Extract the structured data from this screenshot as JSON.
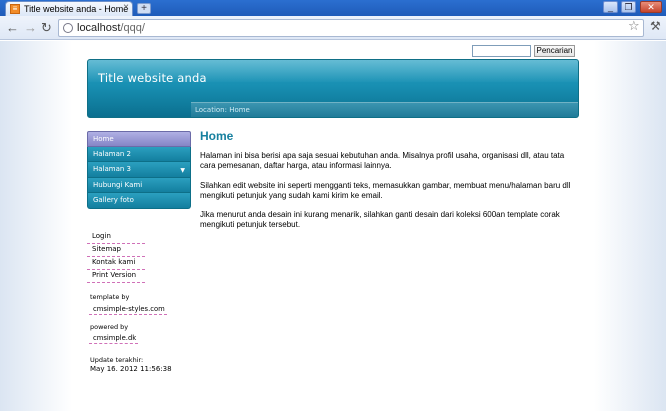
{
  "browser": {
    "tab_title": "Title website anda - Home",
    "tab_close": "×",
    "new_tab": "+",
    "window_buttons": [
      "_",
      "❐",
      "✕"
    ],
    "nav": {
      "back": "←",
      "forward": "→",
      "reload": "↻"
    },
    "url_host": "localhost",
    "url_path": "/qqq/",
    "star": "☆",
    "wrench": "🔧"
  },
  "search": {
    "button_label": "Pencarian",
    "value": ""
  },
  "header": {
    "site_title": "Title website anda",
    "location": "Location: Home"
  },
  "menu": {
    "items": [
      {
        "label": "Home"
      },
      {
        "label": "Halaman 2"
      },
      {
        "label": "Halaman 3",
        "arrow": "▼"
      },
      {
        "label": "Hubungi Kami"
      },
      {
        "label": "Gallery foto"
      }
    ]
  },
  "side_links": [
    "Login",
    "Sitemap",
    "Kontak kami",
    "Print Version"
  ],
  "sidebar_footer": {
    "template_label": "template by",
    "template_link": "cmsimple-styles.com",
    "powered_label": "powered by",
    "powered_link": "cmsimple.dk",
    "updated_label": "Update terakhir:",
    "updated_value": "May 16. 2012 11:56:38"
  },
  "main": {
    "title": "Home",
    "paragraphs": [
      "Halaman ini bisa berisi apa saja sesuai kebutuhan anda. Misalnya profil usaha, organisasi dll, atau tata cara pemesanan, daftar harga, atau informasi lainnya.",
      "Silahkan edit website ini seperti mengganti teks, memasukkan gambar, membuat menu/halaman baru dll mengikuti petunjuk yang sudah kami kirim ke email.",
      "Jika menurut anda desain ini kurang menarik, silahkan ganti desain dari koleksi 600an template corak mengikuti petunjuk tersebut."
    ]
  }
}
